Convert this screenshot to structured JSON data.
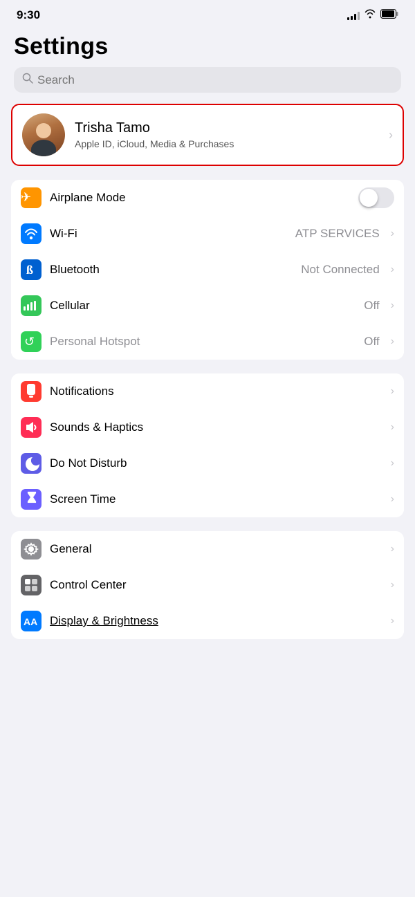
{
  "statusBar": {
    "time": "9:30",
    "signal": [
      3,
      5,
      7,
      9,
      11
    ],
    "wifi": true,
    "battery": true
  },
  "pageTitle": "Settings",
  "search": {
    "placeholder": "Search"
  },
  "profile": {
    "name": "Trisha Tamo",
    "subtitle": "Apple ID, iCloud, Media & Purchases"
  },
  "groups": [
    {
      "id": "connectivity",
      "rows": [
        {
          "id": "airplane-mode",
          "label": "Airplane Mode",
          "value": "",
          "toggle": true,
          "toggleOn": false,
          "iconBg": "ic-orange",
          "iconSymbol": "✈"
        },
        {
          "id": "wifi",
          "label": "Wi-Fi",
          "value": "ATP SERVICES",
          "toggle": false,
          "iconBg": "ic-blue",
          "iconSymbol": "wifi"
        },
        {
          "id": "bluetooth",
          "label": "Bluetooth",
          "value": "Not Connected",
          "toggle": false,
          "iconBg": "ic-blue-dark",
          "iconSymbol": "bt"
        },
        {
          "id": "cellular",
          "label": "Cellular",
          "value": "Off",
          "toggle": false,
          "iconBg": "ic-green",
          "iconSymbol": "signal"
        },
        {
          "id": "hotspot",
          "label": "Personal Hotspot",
          "value": "Off",
          "toggle": false,
          "iconBg": "ic-green2",
          "iconSymbol": "hotspot",
          "dimmed": true
        }
      ]
    },
    {
      "id": "notifications",
      "rows": [
        {
          "id": "notifications",
          "label": "Notifications",
          "value": "",
          "toggle": false,
          "iconBg": "ic-red",
          "iconSymbol": "notif"
        },
        {
          "id": "sounds",
          "label": "Sounds & Haptics",
          "value": "",
          "toggle": false,
          "iconBg": "ic-red-pink",
          "iconSymbol": "sound"
        },
        {
          "id": "dnd",
          "label": "Do Not Disturb",
          "value": "",
          "toggle": false,
          "iconBg": "ic-indigo",
          "iconSymbol": "moon"
        },
        {
          "id": "screentime",
          "label": "Screen Time",
          "value": "",
          "toggle": false,
          "iconBg": "ic-purple2",
          "iconSymbol": "hourglass"
        }
      ]
    },
    {
      "id": "general",
      "rows": [
        {
          "id": "general",
          "label": "General",
          "value": "",
          "toggle": false,
          "iconBg": "ic-gray",
          "iconSymbol": "gear"
        },
        {
          "id": "control-center",
          "label": "Control Center",
          "value": "",
          "toggle": false,
          "iconBg": "ic-gray2",
          "iconSymbol": "cc"
        },
        {
          "id": "display",
          "label": "Display & Brightness",
          "value": "",
          "toggle": false,
          "iconBg": "ic-blue",
          "iconSymbol": "AA",
          "underlined": true
        }
      ]
    }
  ]
}
